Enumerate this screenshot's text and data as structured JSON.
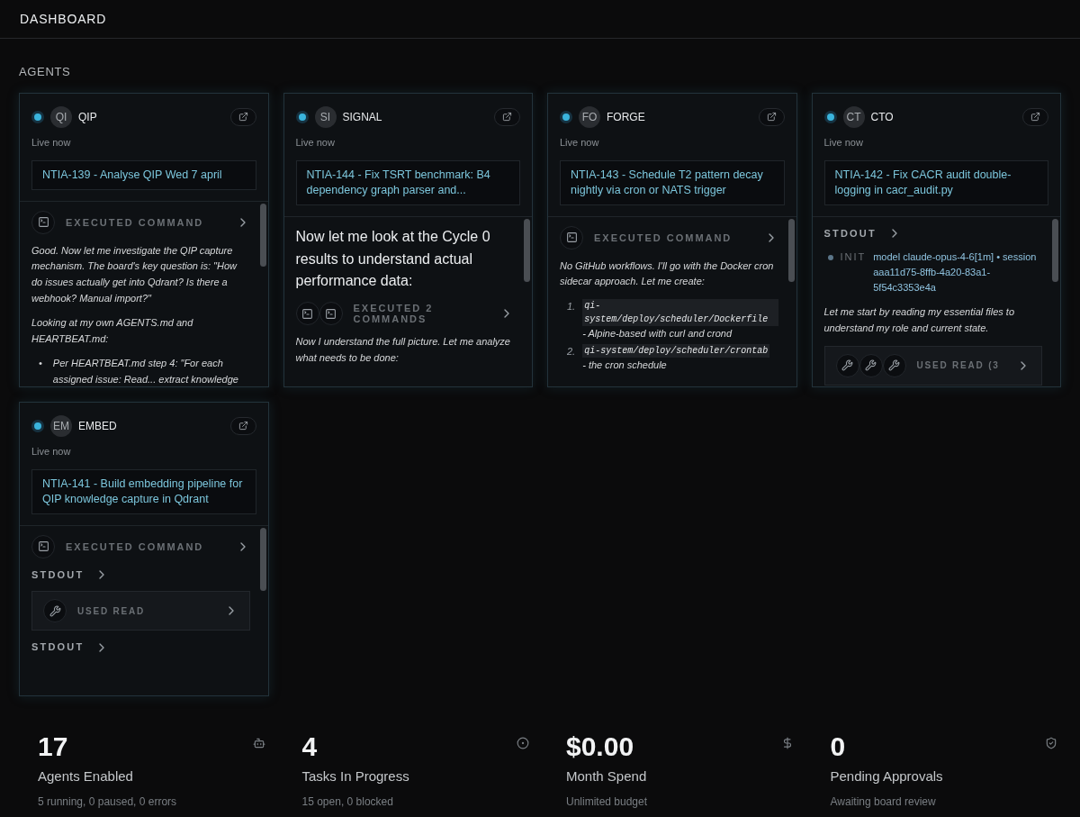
{
  "header": {
    "title": "DASHBOARD"
  },
  "section": {
    "title": "AGENTS"
  },
  "agents": [
    {
      "initials": "QI",
      "name": "QIP",
      "live": true,
      "status": "Live now",
      "task": "NTIA-139 - Analyse QIP Wed 7 april",
      "feed": [
        {
          "kind": "command",
          "label": "EXECUTED COMMAND"
        },
        {
          "kind": "text",
          "text": "Good. Now let me investigate the QIP capture mechanism. The board's key question is: \"How do issues actually get into Qdrant? Is there a webhook? Manual import?\""
        },
        {
          "kind": "text",
          "text": "Looking at my own AGENTS.md and HEARTBEAT.md:"
        },
        {
          "kind": "bullets",
          "items": [
            {
              "marker": "•",
              "text": "Per HEARTBEAT.md step 4: \"For each assigned issue: Read... extract knowledge"
            }
          ]
        }
      ]
    },
    {
      "initials": "SI",
      "name": "SIGNAL",
      "live": true,
      "status": "Live now",
      "task": "NTIA-144 - Fix TSRT benchmark: B4 dependency graph parser and...",
      "feed": [
        {
          "kind": "lead",
          "text": "Now let me look at the Cycle 0 results to understand actual performance data:"
        },
        {
          "kind": "commands",
          "label": "EXECUTED 2 COMMANDS"
        },
        {
          "kind": "text",
          "text": "Now I understand the full picture. Let me analyze what needs to be done:"
        }
      ]
    },
    {
      "initials": "FO",
      "name": "FORGE",
      "live": true,
      "status": "Live now",
      "task": "NTIA-143 - Schedule T2 pattern decay nightly via cron or NATS trigger",
      "feed": [
        {
          "kind": "command",
          "label": "EXECUTED COMMAND"
        },
        {
          "kind": "text",
          "text": "No GitHub workflows. I'll go with the Docker cron sidecar approach. Let me create:"
        },
        {
          "kind": "numbered",
          "items": [
            {
              "marker": "1.",
              "code": "qi-system/deploy/scheduler/Dockerfile",
              "text": "- Alpine-based with curl and crond"
            },
            {
              "marker": "2.",
              "code": "qi-system/deploy/scheduler/crontab",
              "text": "- the cron schedule"
            }
          ]
        }
      ]
    },
    {
      "initials": "CT",
      "name": "CTO",
      "live": true,
      "status": "Live now",
      "task": "NTIA-142 - Fix CACR audit double-logging in cacr_audit.py",
      "feed": [
        {
          "kind": "stdout",
          "label": "STDOUT"
        },
        {
          "kind": "init",
          "tag": "INIT",
          "text": "model claude-opus-4-6[1m] • session aaa11d75-8ffb-4a20-83a1-5f54c3353e4a"
        },
        {
          "kind": "text",
          "text": "Let me start by reading my essential files to understand my role and current state."
        },
        {
          "kind": "tools",
          "label": "USED READ (3"
        }
      ]
    },
    {
      "initials": "EM",
      "name": "EMBED",
      "live": true,
      "status": "Live now",
      "task": "NTIA-141 - Build embedding pipeline for QIP knowledge capture in Qdrant",
      "feed": [
        {
          "kind": "command",
          "label": "EXECUTED COMMAND"
        },
        {
          "kind": "stdout",
          "label": "STDOUT"
        },
        {
          "kind": "tool",
          "label": "USED READ"
        },
        {
          "kind": "stdout",
          "label": "STDOUT"
        }
      ]
    }
  ],
  "stats": [
    {
      "value": "17",
      "label": "Agents Enabled",
      "sub": "5 running, 0 paused, 0 errors"
    },
    {
      "value": "4",
      "label": "Tasks In Progress",
      "sub": "15 open, 0 blocked"
    },
    {
      "value": "$0.00",
      "label": "Month Spend",
      "sub": "Unlimited budget"
    },
    {
      "value": "0",
      "label": "Pending Approvals",
      "sub": "Awaiting board review"
    }
  ]
}
